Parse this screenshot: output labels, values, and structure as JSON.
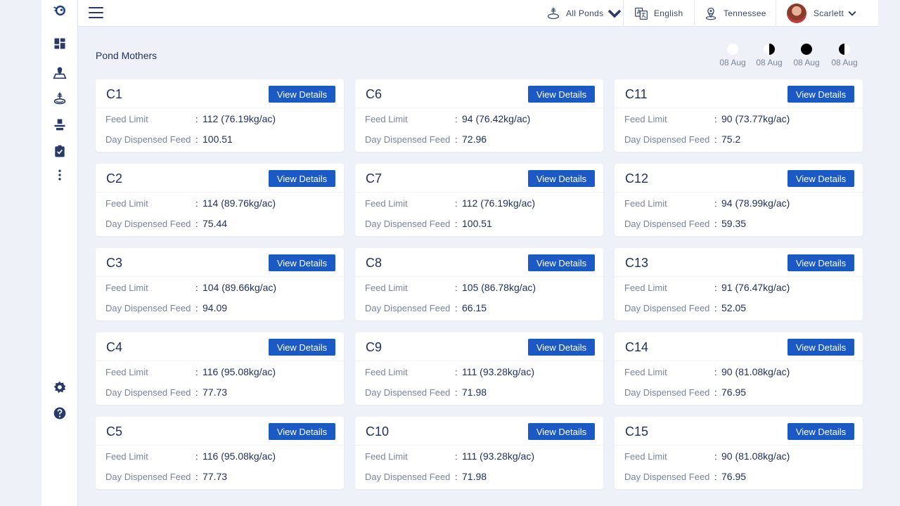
{
  "header": {
    "ponds_label": "All Ponds",
    "language_label": "English",
    "location_label": "Tennessee",
    "user_name": "Scarlett"
  },
  "page": {
    "title": "Pond Mothers"
  },
  "moon_phases": [
    {
      "date": "08 Aug",
      "phase": "full"
    },
    {
      "date": "08 Aug",
      "phase": "first-quarter"
    },
    {
      "date": "08 Aug",
      "phase": "new"
    },
    {
      "date": "08 Aug",
      "phase": "last-quarter"
    }
  ],
  "labels": {
    "feed_limit": "Feed Limit",
    "day_dispensed": "Day Dispensed Feed",
    "colon": ":",
    "view_details": "View Details"
  },
  "cards": [
    {
      "name": "C1",
      "feed_limit": "112 (76.19kg/ac)",
      "dispensed": "100.51"
    },
    {
      "name": "C2",
      "feed_limit": "114 (89.76kg/ac)",
      "dispensed": "75.44"
    },
    {
      "name": "C3",
      "feed_limit": "104 (89.66kg/ac)",
      "dispensed": "94.09"
    },
    {
      "name": "C4",
      "feed_limit": "116 (95.08kg/ac)",
      "dispensed": "77.73"
    },
    {
      "name": "C5",
      "feed_limit": "116 (95.08kg/ac)",
      "dispensed": "77.73"
    },
    {
      "name": "C6",
      "feed_limit": "94 (76.42kg/ac)",
      "dispensed": "72.96"
    },
    {
      "name": "C7",
      "feed_limit": "112 (76.19kg/ac)",
      "dispensed": "100.51"
    },
    {
      "name": "C8",
      "feed_limit": "105 (86.78kg/ac)",
      "dispensed": "66.15"
    },
    {
      "name": "C9",
      "feed_limit": "111 (93.28kg/ac)",
      "dispensed": "71.98"
    },
    {
      "name": "C10",
      "feed_limit": "111 (93.28kg/ac)",
      "dispensed": "71.98"
    },
    {
      "name": "C11",
      "feed_limit": "90 (73.77kg/ac)",
      "dispensed": "75.2"
    },
    {
      "name": "C12",
      "feed_limit": "94 (78.99kg/ac)",
      "dispensed": "59.35"
    },
    {
      "name": "C13",
      "feed_limit": "91 (76.47kg/ac)",
      "dispensed": "52.05"
    },
    {
      "name": "C14",
      "feed_limit": "90 (81.08kg/ac)",
      "dispensed": "76.95"
    },
    {
      "name": "C15",
      "feed_limit": "90 (81.08kg/ac)",
      "dispensed": "76.95"
    }
  ],
  "colors": {
    "accent": "#1b5ac4",
    "text": "#1f2f5a",
    "muted": "#7a8599",
    "background": "#eef2f8"
  },
  "icons": [
    "logo-icon",
    "dashboard-icon",
    "map-location-icon",
    "pond-icon",
    "pond-mother-icon",
    "checklist-icon",
    "more-vertical-icon",
    "settings-icon",
    "help-icon"
  ]
}
